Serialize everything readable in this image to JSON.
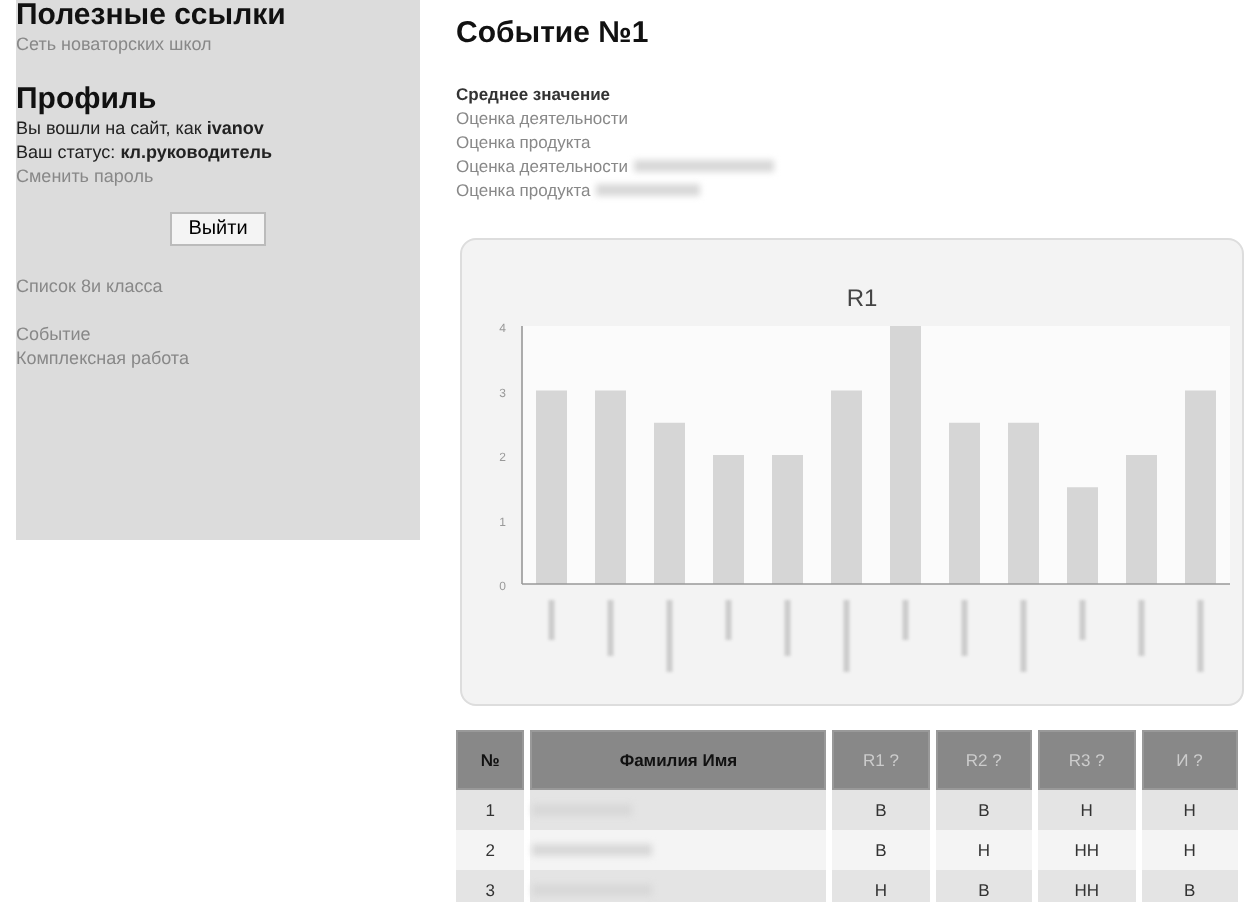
{
  "sidebar": {
    "links_title": "Полезные ссылки",
    "links": [
      "Сеть новаторских школ"
    ],
    "profile_title": "Профиль",
    "login_text": "Вы вошли на сайт, как **ivanov**",
    "status_text": "Ваш статус: **кл.руководитель**",
    "change_password": "Сменить пароль",
    "logout_button": "Выйти",
    "menu_groups": [
      [
        "Список 8и класса"
      ],
      [
        "Событие",
        "Комплексная работа"
      ]
    ]
  },
  "main": {
    "title": "Событие №1",
    "filters": [
      {
        "label": "Среднее значение",
        "selected": true,
        "redacted": false
      },
      {
        "label": "Оценка деятельности",
        "selected": false,
        "redacted": false
      },
      {
        "label": "Оценка продукта",
        "selected": false,
        "redacted": false
      },
      {
        "label": "Оценка деятельности",
        "selected": false,
        "redacted": true
      },
      {
        "label": "Оценка продукта",
        "selected": false,
        "redacted": true
      }
    ],
    "chart_data": {
      "type": "bar",
      "title": "R1",
      "values": [
        3,
        3,
        2.5,
        2,
        2,
        3,
        4,
        2.5,
        2.5,
        1.5,
        2,
        3
      ],
      "ylim": [
        0,
        4
      ],
      "yticks": [
        0,
        1,
        2,
        3,
        4
      ]
    },
    "table": {
      "columns": [
        "№",
        "Фамилия Имя",
        "R1 ?",
        "R2 ?",
        "R3 ?",
        "И ?"
      ],
      "rows": [
        [
          "1",
          "",
          "В",
          "В",
          "Н",
          "Н"
        ],
        [
          "2",
          "",
          "В",
          "Н",
          "НН",
          "Н"
        ],
        [
          "3",
          "",
          "Н",
          "В",
          "НН",
          "В"
        ]
      ]
    }
  }
}
